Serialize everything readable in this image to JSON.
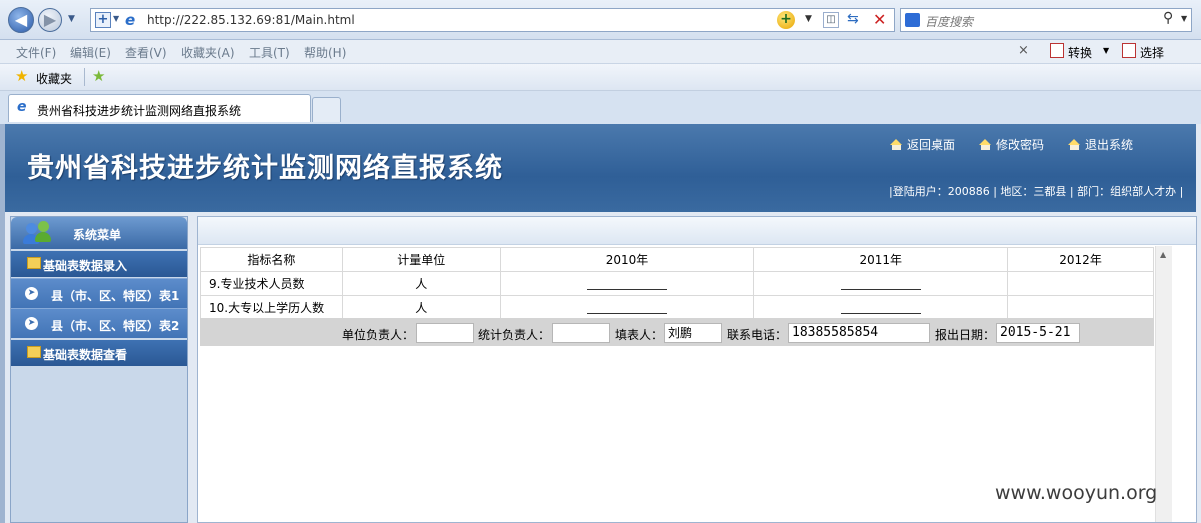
{
  "browser": {
    "url": "http://222.85.132.69:81/Main.html",
    "search_placeholder": "百度搜索",
    "menu": [
      "文件(F)",
      "编辑(E)",
      "查看(V)",
      "收藏夹(A)",
      "工具(T)",
      "帮助(H)"
    ],
    "convert_label": "转换",
    "select_label": "选择",
    "favorites_label": "收藏夹",
    "tab_title": "贵州省科技进步统计监测网络直报系统"
  },
  "header": {
    "title": "贵州省科技进步统计监测网络直报系统",
    "links": [
      "返回桌面",
      "修改密码",
      "退出系统"
    ],
    "user_info": "|登陆用户：200886 | 地区：三都县 | 部门：组织部人才办 |"
  },
  "sidebar": {
    "title": "系统菜单",
    "section1": "基础表数据录入",
    "items": [
      "县（市、区、特区）表1",
      "县（市、区、特区）表2"
    ],
    "section2": "基础表数据查看"
  },
  "table": {
    "headers": [
      "指标名称",
      "计量单位",
      "2010年",
      "2011年",
      "2012年"
    ],
    "rows": [
      {
        "name": "9.专业技术人员数",
        "unit": "人"
      },
      {
        "name": "10.大专以上学历人数",
        "unit": "人"
      }
    ]
  },
  "sign": {
    "unit_head_label": "单位负责人：",
    "unit_head_value": "",
    "stat_head_label": "统计负责人：",
    "stat_head_value": "",
    "filler_label": "填表人：",
    "filler_value": "刘鹏",
    "phone_label": "联系电话：",
    "phone_value": "18385585854",
    "date_label": "报出日期：",
    "date_value": "2015-5-21"
  },
  "watermark": "www.wooyun.org"
}
